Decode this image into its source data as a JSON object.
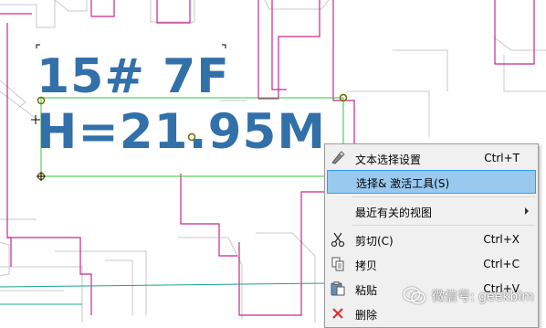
{
  "drawing": {
    "label_line1": "15# 7F",
    "label_line2": "H=21.95M",
    "label_color": "#3270aa",
    "wall_color": "#c8278f",
    "selection_color": "#37c337",
    "grip_color": "#b7b700"
  },
  "context_menu": {
    "items": [
      {
        "label": "文本选择设置",
        "shortcut": "Ctrl+T",
        "icon": "text-settings-icon"
      },
      {
        "label": "选择& 激活工具(S)",
        "shortcut": "",
        "icon": "",
        "highlighted": true
      },
      {
        "label": "最近有关的视图",
        "shortcut": "",
        "icon": "",
        "submenu": true
      },
      {
        "label": "剪切(C)",
        "shortcut": "Ctrl+X",
        "icon": "scissors-icon"
      },
      {
        "label": "拷贝",
        "shortcut": "Ctrl+C",
        "icon": "copy-icon"
      },
      {
        "label": "粘贴",
        "shortcut": "Ctrl+V",
        "icon": "paste-icon"
      },
      {
        "label": "删除",
        "shortcut": "",
        "icon": "delete-icon"
      }
    ]
  },
  "watermark": {
    "text": "微信号: geekbim",
    "icon": "wechat-icon"
  }
}
